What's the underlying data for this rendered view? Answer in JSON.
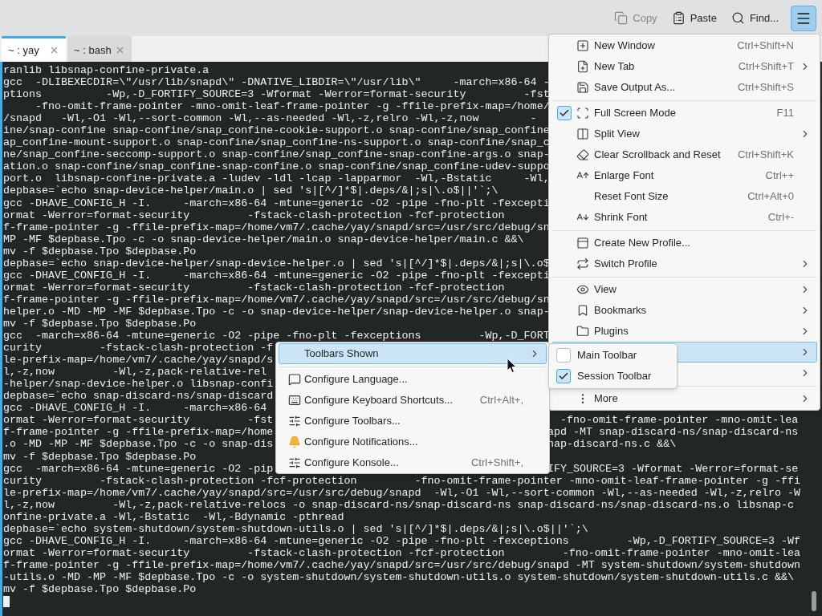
{
  "toolbar": {
    "buttons": [
      {
        "label": "Copy",
        "disabled": true
      },
      {
        "label": "Paste",
        "disabled": false
      },
      {
        "label": "Find...",
        "disabled": false
      }
    ],
    "menu_button": {
      "pressed": true
    }
  },
  "tabs": [
    {
      "label": "~ : yay",
      "selected": true
    },
    {
      "label": "~ : bash",
      "selected": false
    }
  ],
  "terminal": {
    "lines": [
      {
        "text": "ranlib libsnap-confine-private.a"
      },
      {
        "text": "gcc  -DLIBEXECDIR=\\\"/usr/lib/snapd\\\" -DNATIVE_LIBDIR=\\\"/usr/lib\\\"     -march=x86-64 -"
      },
      {
        "text": "ptions          -Wp,-D_FORTIFY_SOURCE=3 -Wformat -Werror=format-security         -fst"
      },
      {
        "text": "     -fno-omit-frame-pointer -mno-omit-leaf-frame-pointer -g -ffile-prefix-map=/home/"
      },
      {
        "text": "/snapd   -Wl,-O1 -Wl,--sort-common -Wl,--as-needed -Wl,-z,relro -Wl,-z,now        -"
      },
      {
        "text": "ine/snap-confine snap-confine/snap_confine-cookie-support.o snap-confine/snap_confine"
      },
      {
        "text": "ap_confine-mount-support.o snap-confine/snap_confine-ns-support.o snap-confine/snap_c"
      },
      {
        "text": "ne/snap_confine-seccomp-support.o snap-confine/snap_confine-snap-confine-args.o snap-"
      },
      {
        "text": "ation.o snap-confine/snap_confine-snap-confine.o snap-confine/snap_confine-udev-suppo"
      },
      {
        "text": "port.o  libsnap-confine-private.a -ludev -ldl -lcap -lapparmor  -Wl,-Bstatic     -Wl,"
      },
      {
        "text": "depbase=`echo snap-device-helper/main.o | sed 's|[^/]*$|.deps/&|;s|\\.o$||'`;\\"
      },
      {
        "text": "gcc -DHAVE_CONFIG_H -I.     -march=x86-64 -mtune=generic -O2 -pipe -fno-plt -fexcepti"
      },
      {
        "text": "ormat -Werror=format-security         -fstack-clash-protection -fcf-protection"
      },
      {
        "text": "f-frame-pointer -g -ffile-prefix-map=/home/vm7/.cache/yay/snapd/src=/usr/src/debug/sn"
      },
      {
        "text": "MP -MF $depbase.Tpo -c -o snap-device-helper/main.o snap-device-helper/main.c &&\\"
      },
      {
        "text": "mv -f $depbase.Tpo $depbase.Po"
      },
      {
        "text": "depbase=`echo snap-device-helper/snap-device-helper.o | sed 's|[^/]*$|.deps/&|;s|\\.o$"
      },
      {
        "text": "gcc -DHAVE_CONFIG_H -I.     -march=x86-64 -mtune=generic -O2 -pipe -fno-plt -fexcepti"
      },
      {
        "text": "ormat -Werror=format-security         -fstack-clash-protection -fcf-protection"
      },
      {
        "text": "f-frame-pointer -g -ffile-prefix-map=/home/vm7/.cache/yay/snapd/src=/usr/src/debug/sn"
      },
      {
        "text": "helper.o -MD -MP -MF $depbase.Tpo -c -o snap-device-helper/snap-device-helper.o snap-"
      },
      {
        "text": "mv -f $depbase.Tpo $depbase.Po"
      },
      {
        "text": "gcc  -march=x86-64 -mtune=generic -O2 -pipe -fno-plt -fexceptions         -Wp,-D_FORT"
      },
      {
        "text": "curity         -fstack-clash-protection -f"
      },
      {
        "text": "le-prefix-map=/home/vm7/.cache/yay/snapd/s"
      },
      {
        "text": "l,-z,now         -Wl,-z,pack-relative-rel"
      },
      {
        "text": "-helper/snap-device-helper.o libsnap-confi"
      },
      {
        "text": "depbase=`echo snap-discard-ns/snap-discard"
      },
      {
        "text": "gcc -DHAVE_CONFIG_H -I.     -march=x86-64"
      },
      {
        "text": "ormat -Werror=format-security         -fst",
        "right": "  -fno-omit-frame-pointer -mno-omit-lea"
      },
      {
        "text": "f-frame-pointer -g -ffile-prefix-map=/home",
        "right": "apd -MT snap-discard-ns/snap-discard-ns"
      },
      {
        "text": ".o -MD -MP -MF $depbase.Tpo -c -o snap-dis",
        "right": "nap-discard-ns.c &&\\"
      },
      {
        "text": "mv -f $depbase.Tpo $depbase.Po"
      },
      {
        "text": "gcc  -march=x86-64 -mtune=generic -O2 -pip",
        "right": "IFY_SOURCE=3 -Wformat -Werror=format-se"
      },
      {
        "text": "curity         -fstack-clash-protection -fcf-protection         -fno-omit-frame-pointer -mno-omit-leaf-frame-pointer -g -ffi"
      },
      {
        "text": "le-prefix-map=/home/vm7/.cache/yay/snapd/src=/usr/src/debug/snapd  -Wl,-O1 -Wl,--sort-common -Wl,--as-needed -Wl,-z,relro -W"
      },
      {
        "text": "l,-z,now         -Wl,-z,pack-relative-relocs -o snap-discard-ns/snap-discard-ns snap-discard-ns/snap-discard-ns.o libsnap-c"
      },
      {
        "text": "onfine-private.a -Wl,-Bstatic  -Wl,-Bdynamic -pthread"
      },
      {
        "text": "depbase=`echo system-shutdown/system-shutdown-utils.o | sed 's|[^/]*$|.deps/&|;s|\\.o$||'`;\\"
      },
      {
        "text": "gcc -DHAVE_CONFIG_H -I.     -march=x86-64 -mtune=generic -O2 -pipe -fno-plt -fexceptions         -Wp,-D_FORTIFY_SOURCE=3 -Wf"
      },
      {
        "text": "ormat -Werror=format-security         -fstack-clash-protection -fcf-protection         -fno-omit-frame-pointer -mno-omit-lea"
      },
      {
        "text": "f-frame-pointer -g -ffile-prefix-map=/home/vm7/.cache/yay/snapd/src=/usr/src/debug/snapd -MT system-shutdown/system-shutdown"
      },
      {
        "text": "-utils.o -MD -MP -MF $depbase.Tpo -c -o system-shutdown/system-shutdown-utils.o system-shutdown/system-shutdown-utils.c &&\\"
      },
      {
        "text": "mv -f $depbase.Tpo $depbase.Po"
      }
    ]
  },
  "main_menu": {
    "items": [
      {
        "kind": "action",
        "label": "New Window",
        "shortcut": "Ctrl+Shift+N",
        "submenu": false,
        "selected": false
      },
      {
        "kind": "action",
        "label": "New Tab",
        "shortcut": "Ctrl+Shift+T",
        "submenu": true,
        "selected": false
      },
      {
        "kind": "action",
        "label": "Save Output As...",
        "shortcut": "Ctrl+Shift+S",
        "submenu": false,
        "selected": false
      },
      {
        "kind": "separator"
      },
      {
        "kind": "check",
        "label": "Full Screen Mode",
        "shortcut": "F11",
        "checked": true,
        "submenu": false,
        "selected": false
      },
      {
        "kind": "action",
        "label": "Split View",
        "submenu": true,
        "selected": false
      },
      {
        "kind": "action",
        "label": "Clear Scrollback and Reset",
        "shortcut": "Ctrl+Shift+K",
        "submenu": false,
        "selected": false
      },
      {
        "kind": "action",
        "label": "Enlarge Font",
        "shortcut": "Ctrl++",
        "submenu": false,
        "selected": false
      },
      {
        "kind": "action",
        "label": "Reset Font Size",
        "shortcut": "Ctrl+Alt+0",
        "submenu": false,
        "selected": false
      },
      {
        "kind": "action",
        "label": "Shrink Font",
        "shortcut": "Ctrl+-",
        "submenu": false,
        "selected": false
      },
      {
        "kind": "separator"
      },
      {
        "kind": "action",
        "label": "Create New Profile...",
        "submenu": false,
        "selected": false
      },
      {
        "kind": "action",
        "label": "Switch Profile",
        "submenu": true,
        "selected": false
      },
      {
        "kind": "separator"
      },
      {
        "kind": "action",
        "label": "View",
        "submenu": true,
        "selected": false
      },
      {
        "kind": "action",
        "label": "Bookmarks",
        "submenu": true,
        "selected": false
      },
      {
        "kind": "action",
        "label": "Plugins",
        "submenu": true,
        "selected": false
      },
      {
        "kind": "covered",
        "submenu": true,
        "selected": true
      },
      {
        "kind": "covered",
        "submenu": true,
        "selected": false
      },
      {
        "kind": "separator"
      },
      {
        "kind": "action",
        "label": "More",
        "submenu": true,
        "selected": false
      }
    ]
  },
  "settings_submenu": {
    "items": [
      {
        "kind": "action",
        "label": "Toolbars Shown",
        "submenu": true,
        "selected": true
      },
      {
        "kind": "separator"
      },
      {
        "kind": "action",
        "label": "Configure Language...",
        "submenu": false,
        "selected": false
      },
      {
        "kind": "action",
        "label": "Configure Keyboard Shortcuts...",
        "shortcut": "Ctrl+Alt+,",
        "submenu": false,
        "selected": false
      },
      {
        "kind": "action",
        "label": "Configure Toolbars...",
        "submenu": false,
        "selected": false
      },
      {
        "kind": "action",
        "label": "Configure Notifications...",
        "submenu": false,
        "selected": false
      },
      {
        "kind": "action",
        "label": "Configure Konsole...",
        "shortcut": "Ctrl+Shift+,",
        "submenu": false,
        "selected": false
      }
    ]
  },
  "toolbars_submenu": {
    "items": [
      {
        "label": "Main Toolbar",
        "checked": false
      },
      {
        "label": "Session Toolbar",
        "checked": true
      }
    ]
  }
}
